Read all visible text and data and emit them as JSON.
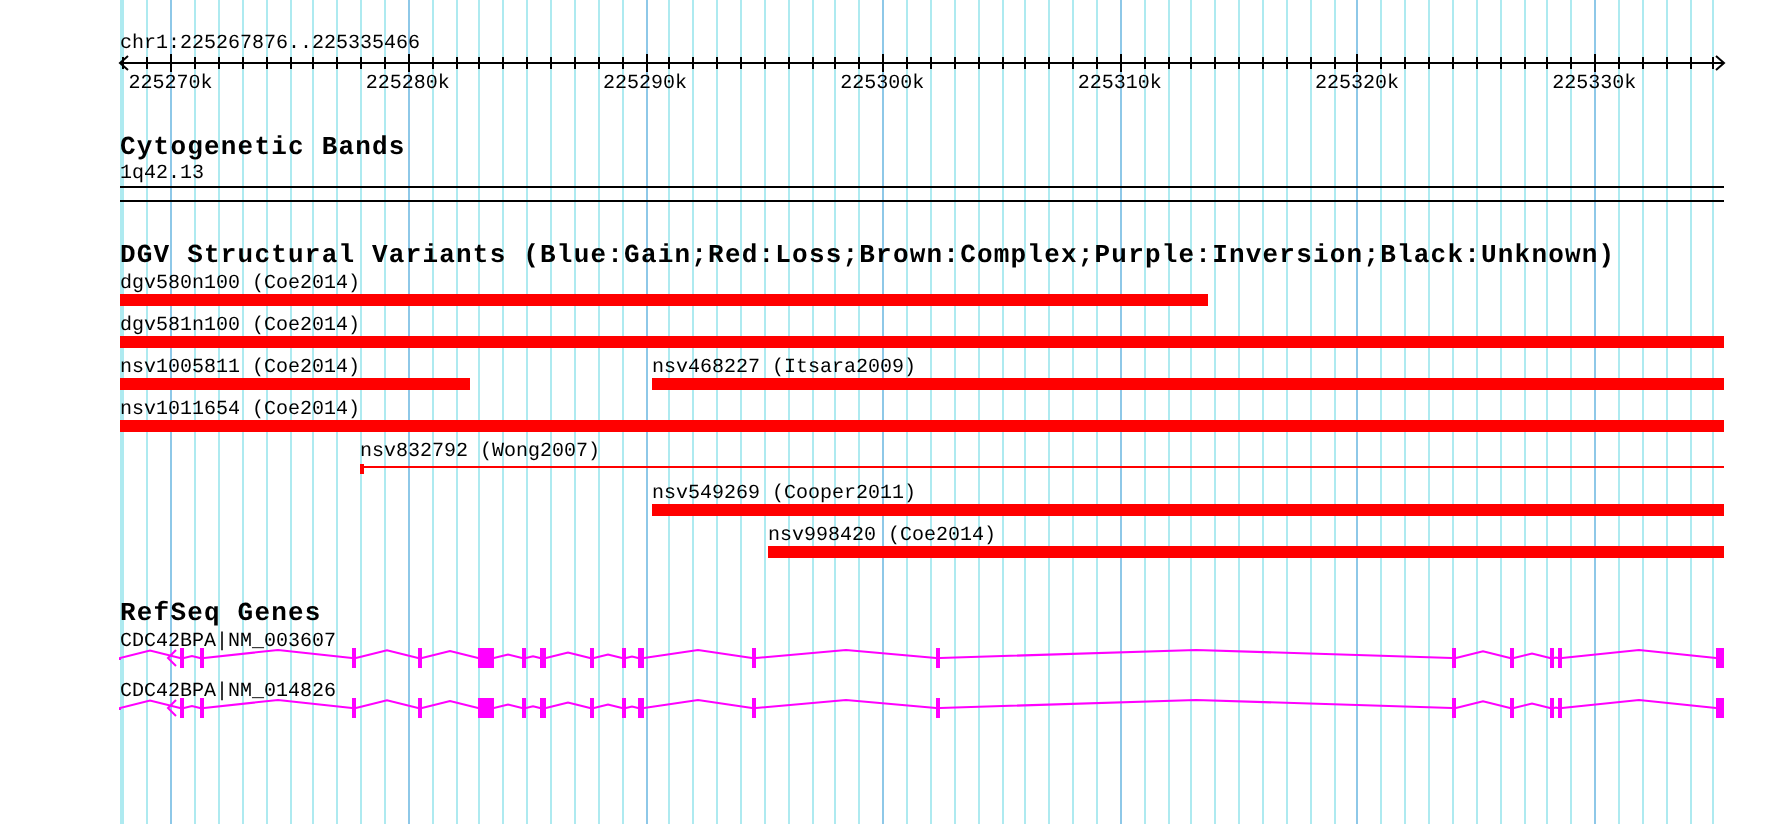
{
  "ruler": {
    "location": "chr1:225267876..225335466",
    "tick_labels": [
      "225270k",
      "225280k",
      "225290k",
      "225300k",
      "225310k",
      "225320k",
      "225330k"
    ]
  },
  "tracks": [
    {
      "kind": "cytoband",
      "title": "Cytogenetic Bands",
      "features": [
        {
          "label": "1q42.13"
        }
      ]
    },
    {
      "kind": "variants",
      "title": "DGV Structural Variants (Blue:Gain;Red:Loss;Brown:Complex;Purple:Inversion;Black:Unknown)",
      "features": [
        {
          "label": "dgv580n100 (Coe2014)"
        },
        {
          "label": "dgv581n100 (Coe2014)"
        },
        {
          "label": "nsv1005811 (Coe2014)"
        },
        {
          "label": "nsv468227 (Itsara2009)"
        },
        {
          "label": "nsv1011654 (Coe2014)"
        },
        {
          "label": "nsv832792 (Wong2007)"
        },
        {
          "label": "nsv549269 (Cooper2011)"
        },
        {
          "label": "nsv998420 (Coe2014)"
        }
      ]
    },
    {
      "kind": "genes",
      "title": "RefSeq Genes",
      "features": [
        {
          "label": "CDC42BPA|NM_003607"
        },
        {
          "label": "CDC42BPA|NM_014826"
        }
      ]
    }
  ]
}
